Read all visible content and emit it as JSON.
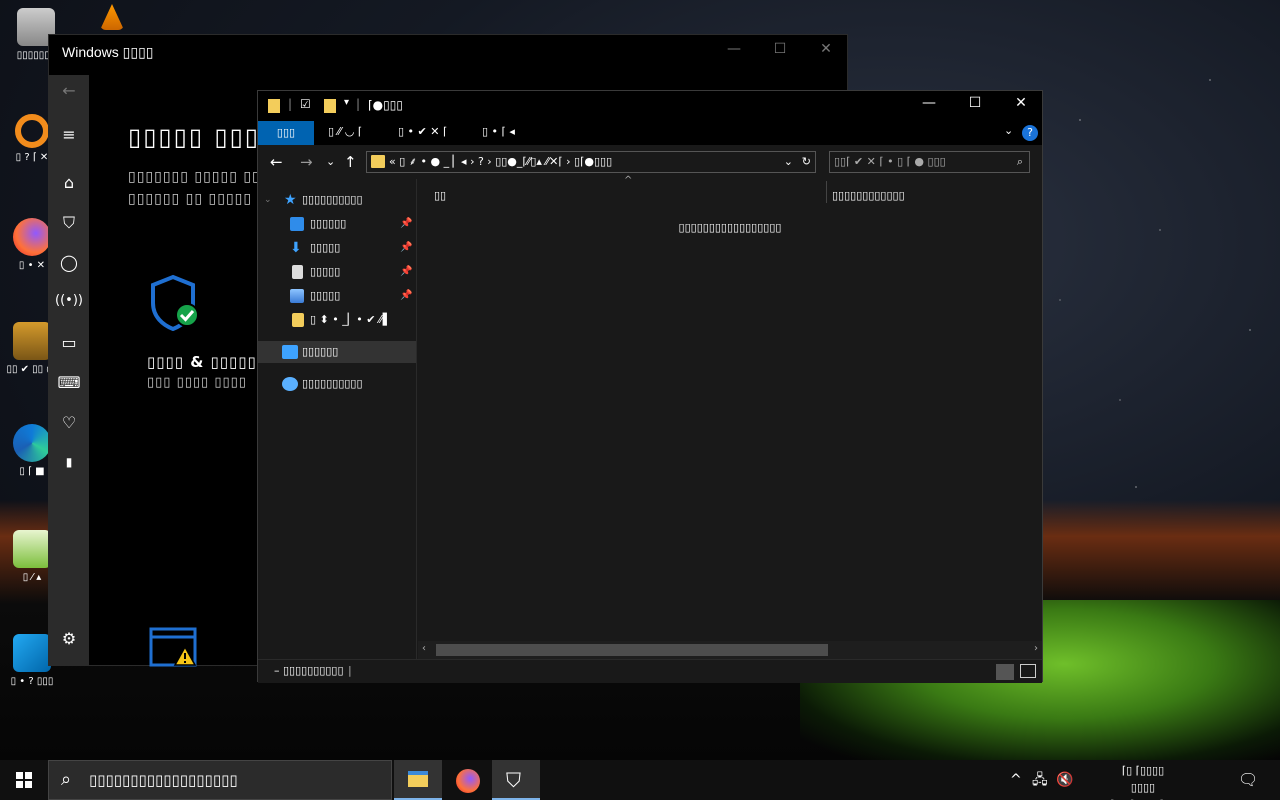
{
  "desktop": {
    "icons": [
      {
        "label": "▯▯▯▯▯▯▯"
      },
      {
        "label": "▯ ? ⌈ ✕"
      },
      {
        "label": "▯ • ✕"
      },
      {
        "label": "▯▯ ✔ ▯▯ ◯"
      },
      {
        "label": "▯ ⌈ ■"
      },
      {
        "label": "▯ ⁄ ▴"
      },
      {
        "label": "▯ • ? ▯▯▯"
      }
    ]
  },
  "security_window": {
    "title": "Windows ▯▯▯▯",
    "controls": {
      "minimize": "—",
      "maximize": "☐",
      "close": "✕"
    },
    "heading": "▯▯▯▯▯ ▯▯▯",
    "subtitle_line1": "▯▯▯▯▯▯▯ ▯▯▯▯▯ ▯▯▯▯",
    "subtitle_line2": "▯▯▯▯▯▯ ▯▯ ▯▯▯▯▯",
    "tile_title": "▯▯▯▯ & ▯▯▯▯▯",
    "tile_subtitle": "▯▯▯ ▯▯▯▯ ▯▯▯▯",
    "rail_icons": [
      "back-icon",
      "menu-icon",
      "home-icon",
      "shield-icon",
      "account-icon",
      "network-icon",
      "app-browser-icon",
      "device-icon",
      "health-icon",
      "family-icon",
      "settings-icon"
    ]
  },
  "explorer": {
    "title": "⌈●▯▯▯",
    "controls": {
      "minimize": "—",
      "maximize": "☐",
      "close": "✕"
    },
    "ribbon_tabs": {
      "file": "▯▯▯",
      "tab1": "▯ ⁄⁄ ◡ ⌈",
      "tab2": "▯ • ✔ ✕ ⌈",
      "tab3": "▯ • ⌈ ◂"
    },
    "help": "?",
    "address": "« ▯ ⸙ • ● _ ▏◂  ›  ? › ▯▯●_⌈⁄⁄▯▴ ⁄⁄✕⌈ › ▯⌈●▯▯▯",
    "search_placeholder": "▯▯⌈ ✔ ✕ ⌈ • ▯ ⌈ ● ▯▯▯",
    "nav": {
      "quick_access": "▯▯▯▯▯▯▯▯▯▯",
      "items": [
        {
          "label": "▯▯▯▯▯▯"
        },
        {
          "label": "▯▯▯▯▯"
        },
        {
          "label": "▯▯▯▯▯"
        },
        {
          "label": "▯▯▯▯▯"
        },
        {
          "label": "▯ ⬍ • _▏• ✔ ⁄⁄▌"
        }
      ],
      "this_pc": "▯▯▯▯▯▯",
      "network": "▯▯▯▯▯▯▯▯▯▯"
    },
    "columns": {
      "name": "▯▯",
      "other": "▯▯▯▯▯▯▯▯▯▯▯▯"
    },
    "empty_message": "▯▯▯▯▯▯▯▯▯▯▯▯▯▯▯▯▯",
    "status": "– ▯▯▯▯▯▯▯▯▯▯"
  },
  "taskbar": {
    "search_placeholder": "▯▯▯▯▯▯▯▯▯▯▯▯▯▯▯▯▯▯",
    "clock_line1": "⌈▯ ⌈▯▯▯▯",
    "clock_line2": "▯▯▯▯",
    "clock_line3": "▯⌈▯▯ ⌈▯▯ ▯ ⌈▯▯▯"
  },
  "colors": {
    "accent": "#0063b1",
    "folder": "#f3cd5b",
    "shield_blue": "#1f6fd1",
    "check_green": "#16a34a",
    "warning_yellow": "#f5c518"
  }
}
